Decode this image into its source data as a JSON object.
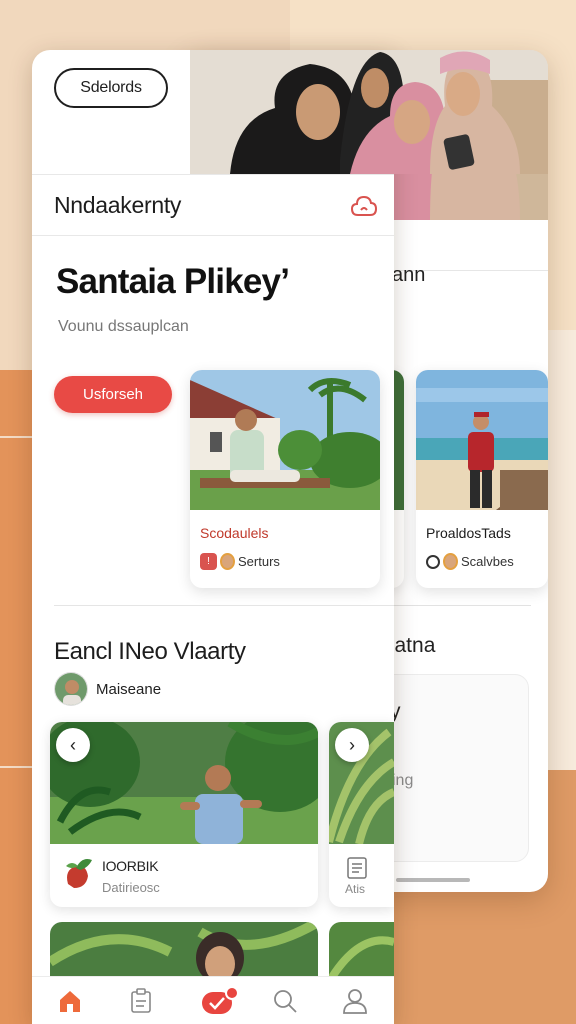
{
  "top": {
    "pill_label": "Sdelords"
  },
  "header": {
    "title": "Nndaakernty"
  },
  "hero": {
    "title": "Santaia Plikey’",
    "subtitle": "Vounu dssauplcan",
    "cta_label": "Usforseh"
  },
  "products": [
    {
      "title": "Scodaulels",
      "meta": "Serturs",
      "title_color": "#c0392b"
    },
    {
      "title": "ProaldosTads",
      "meta": "Scalvbes",
      "title_color": "#222222"
    }
  ],
  "section": {
    "title": "Eancl INeo Vlaarty",
    "author": "Maiseane",
    "feature_title": "IOORBIK",
    "feature_sub": "Datirieosc",
    "side_label": "Atis"
  },
  "back_card": {
    "title_fragment": "ann",
    "section_fragment": "catna",
    "panel_fragment_1": "y",
    "panel_fragment_2": "ing"
  },
  "nav": {
    "items": [
      {
        "name": "home",
        "icon": "home-icon",
        "active": true
      },
      {
        "name": "documents",
        "icon": "document-icon",
        "active": false
      },
      {
        "name": "tasks",
        "icon": "check-badge-icon",
        "active": false
      },
      {
        "name": "search",
        "icon": "search-icon",
        "active": false
      },
      {
        "name": "profile",
        "icon": "user-icon",
        "active": false
      }
    ]
  },
  "colors": {
    "accent": "#e84a45",
    "background": "#e39a63",
    "card": "#ffffff"
  }
}
